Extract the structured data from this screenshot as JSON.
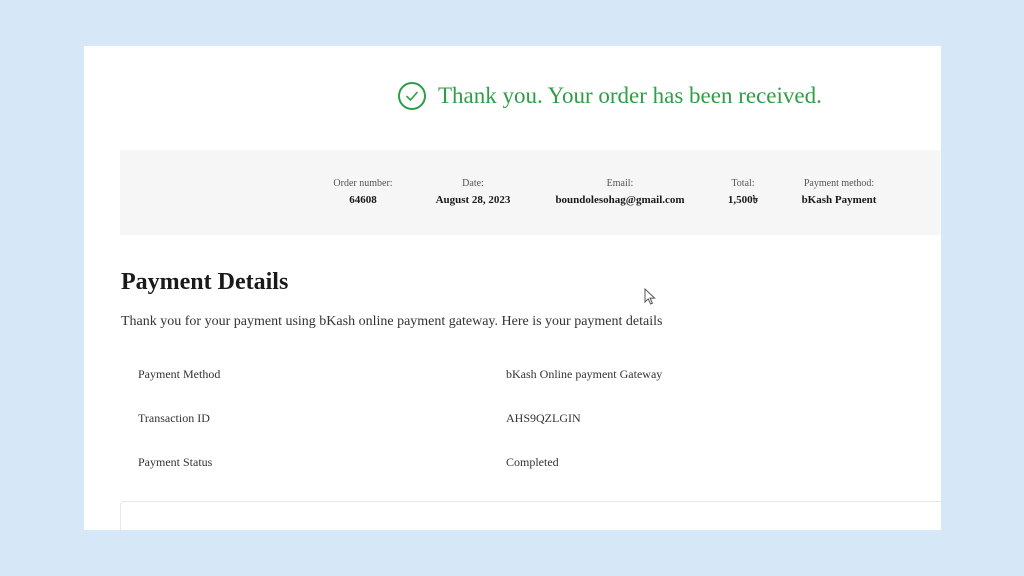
{
  "confirmation": {
    "message": "Thank you. Your order has been received.",
    "icon": "check-circle-icon",
    "color": "#2e9e47"
  },
  "order_overview": [
    {
      "label": "Order number:",
      "value": "64608"
    },
    {
      "label": "Date:",
      "value": "August 28, 2023"
    },
    {
      "label": "Email:",
      "value": "boundolesohag@gmail.com"
    },
    {
      "label": "Total:",
      "value": "1,500৳"
    },
    {
      "label": "Payment method:",
      "value": "bKash Payment"
    }
  ],
  "payment_details": {
    "title": "Payment Details",
    "description": "Thank you for your payment using bKash online payment gateway. Here is your payment details",
    "rows": [
      {
        "label": "Payment Method",
        "value": "bKash Online payment Gateway"
      },
      {
        "label": "Transaction ID",
        "value": "AHS9QZLGIN"
      },
      {
        "label": "Payment Status",
        "value": "Completed"
      }
    ]
  }
}
